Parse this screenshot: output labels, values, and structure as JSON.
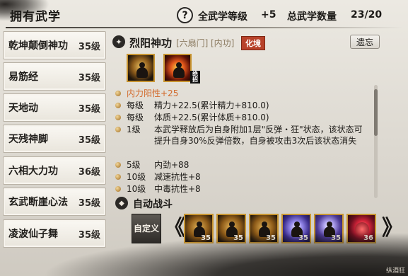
{
  "header": {
    "title": "拥有武学",
    "help": "?",
    "global_level_label": "全武学等级",
    "global_level_value": "+5",
    "total_label": "总武学数量",
    "total_value": "23/20"
  },
  "skills": [
    {
      "name": "乾坤颠倒神功",
      "level": "35级"
    },
    {
      "name": "易筋经",
      "level": "35级"
    },
    {
      "name": "天地动",
      "level": "35级"
    },
    {
      "name": "天残神脚",
      "level": "35级"
    },
    {
      "name": "六相大力功",
      "level": "36级"
    },
    {
      "name": "玄武断崖心法",
      "level": "35级"
    },
    {
      "name": "凌波仙子舞",
      "level": "35级"
    }
  ],
  "detail": {
    "name": "烈阳神功",
    "tag1": "[六扇门]",
    "tag2": "[内功]",
    "tag3": "化境",
    "forget_label": "遗忘",
    "badge": "绝招",
    "effects": [
      {
        "label": "",
        "value": "内力阳性+25",
        "highlight": true
      },
      {
        "label": "每级",
        "value": "精力+22.5(累计精力+810.0)"
      },
      {
        "label": "每级",
        "value": "体质+22.5(累计体质+810.0)"
      },
      {
        "label": "1级",
        "value": "本武学释放后为自身附加1层\"反弹・狂\"状态，该状态可提升自身30%反弹倍数，自身被攻击3次后该状态消失"
      },
      {
        "label": "5级",
        "value": "内劲+88"
      },
      {
        "label": "10级",
        "value": "减速抗性+8"
      },
      {
        "label": "10级",
        "value": "中毒抗性+8"
      }
    ]
  },
  "auto_battle": {
    "label": "自动战斗",
    "custom_label": "自定义",
    "slots": [
      {
        "level": "35"
      },
      {
        "level": "35"
      },
      {
        "level": "35"
      },
      {
        "level": "35"
      },
      {
        "level": "35"
      },
      {
        "level": "36"
      }
    ]
  },
  "corner_text": "纵酒狂"
}
